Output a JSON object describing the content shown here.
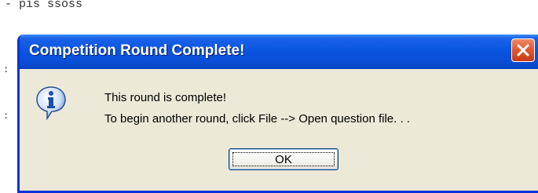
{
  "background": {
    "fragments": [
      "- pis ssoss",
      ":",
      ":"
    ]
  },
  "dialog": {
    "title": "Competition Round Complete!",
    "close_icon": "close-icon",
    "message_icon": "info-icon",
    "message_lines": [
      "This round is complete!",
      "To begin another round, click File --> Open question file. . ."
    ],
    "ok_label": "OK"
  },
  "colors": {
    "titlebar": "#0a55e0",
    "dialog_body": "#ece9d8",
    "close_button": "#e35a32"
  }
}
